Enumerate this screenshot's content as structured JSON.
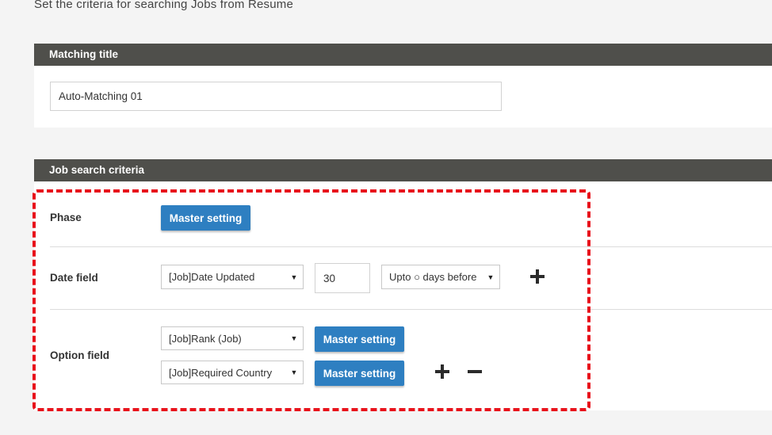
{
  "intro_text": "Set the criteria for searching Jobs from Resume",
  "matching_title": {
    "header": "Matching title",
    "value": "Auto-Matching 01"
  },
  "job_search": {
    "header": "Job search criteria",
    "phase": {
      "label": "Phase",
      "button": "Master setting"
    },
    "date_field": {
      "label": "Date field",
      "field_select": "[Job]Date Updated",
      "days_value": "30",
      "range_select": "Upto ○ days before",
      "add_icon": "plus-icon"
    },
    "option_field": {
      "label": "Option field",
      "rows": [
        {
          "select": "[Job]Rank (Job)",
          "button": "Master setting"
        },
        {
          "select": "[Job]Required Country",
          "button": "Master setting"
        }
      ],
      "add_icon": "plus-icon",
      "remove_icon": "minus-icon"
    }
  },
  "colors": {
    "header_bg": "#4f4f4b",
    "button_bg": "#2e7fc1",
    "highlight": "#e8121b"
  }
}
